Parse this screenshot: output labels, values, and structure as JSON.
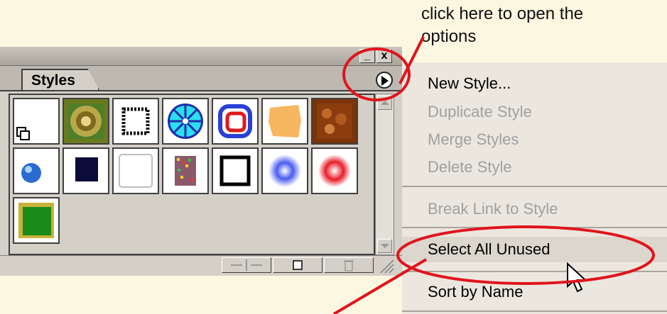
{
  "annotation": {
    "lines": [
      "click here to open the",
      "options"
    ],
    "color": "#e0141c"
  },
  "panel": {
    "tab_label": "Styles",
    "close_glyph": "x",
    "minimize_glyph": "_",
    "menu_button_icon": "triangle-right-icon",
    "swatches": [
      {
        "name": "default-style",
        "style": "white"
      },
      {
        "name": "olive-rings",
        "style": "olive"
      },
      {
        "name": "dotted-frame",
        "style": "dotted"
      },
      {
        "name": "cyan-starburst",
        "style": "burst"
      },
      {
        "name": "blue-red-rings",
        "style": "rings"
      },
      {
        "name": "torn-orange",
        "style": "orange"
      },
      {
        "name": "brown-mosaic",
        "style": "brown"
      },
      {
        "name": "blue-sphere",
        "style": "sphere"
      },
      {
        "name": "dark-navy-square",
        "style": "navy"
      },
      {
        "name": "white-rounded",
        "style": "plain"
      },
      {
        "name": "confetti",
        "style": "confetti"
      },
      {
        "name": "black-brush-frame",
        "style": "brush"
      },
      {
        "name": "blue-glow",
        "style": "blueglow"
      },
      {
        "name": "red-glow",
        "style": "redglow"
      },
      {
        "name": "green-box",
        "style": "green"
      }
    ],
    "bottom_buttons": [
      "break-link-icon",
      "new-style-icon",
      "trash-icon"
    ]
  },
  "menu": {
    "items": [
      {
        "label": "New Style...",
        "underline": "N",
        "enabled": true
      },
      {
        "label": "Duplicate Style",
        "underline": "D",
        "enabled": false
      },
      {
        "label": "Merge Styles",
        "underline": "M",
        "enabled": false
      },
      {
        "label": "Delete Style",
        "underline": "l",
        "enabled": false
      },
      {
        "label": "Break Link to Style",
        "underline": "L",
        "enabled": false
      },
      {
        "label": "Select All Unused",
        "underline": "U",
        "enabled": true,
        "highlighted": true
      },
      {
        "label": "Sort by Name",
        "underline": "S",
        "enabled": true
      }
    ]
  }
}
